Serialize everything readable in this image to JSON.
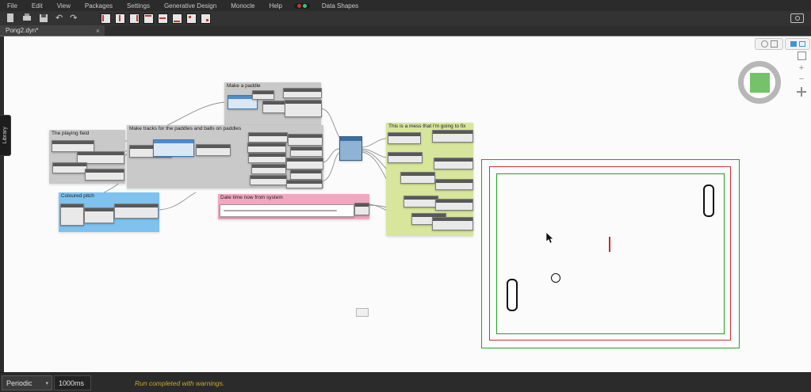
{
  "menu": {
    "items": [
      "File",
      "Edit",
      "View",
      "Packages",
      "Settings",
      "Generative Design",
      "Monocle",
      "Help",
      "Data Shapes"
    ]
  },
  "tab": {
    "title": "Pong2.dyn*",
    "close": "×"
  },
  "library": {
    "label": "Library"
  },
  "groups": {
    "paddle": {
      "title": "Make a paddle"
    },
    "field": {
      "title": "The playing field"
    },
    "tracks": {
      "title": "Make tracks for the paddles and balls on paddles"
    },
    "pitch": {
      "title": "Coloured pitch"
    },
    "datetime": {
      "title": "Date time now from system"
    },
    "mess": {
      "title": "This is a mess that i'm going to fix"
    }
  },
  "controls": {
    "zoom_in": "+",
    "zoom_out": "−"
  },
  "colors": {
    "field_outer": "#1fa51f",
    "field_mid": "#d33030",
    "field_inner": "#1fa51f",
    "accent_blue": "#3f95d8",
    "status_yellow": "#c9a832",
    "group_gray": "#c9c9c9",
    "group_blue": "#7ec3ef",
    "group_pink": "#f2a6c0",
    "group_green": "#d7e69b"
  },
  "footer": {
    "run_mode": "Periodic",
    "interval": "1000ms",
    "status": "Run completed with warnings."
  }
}
